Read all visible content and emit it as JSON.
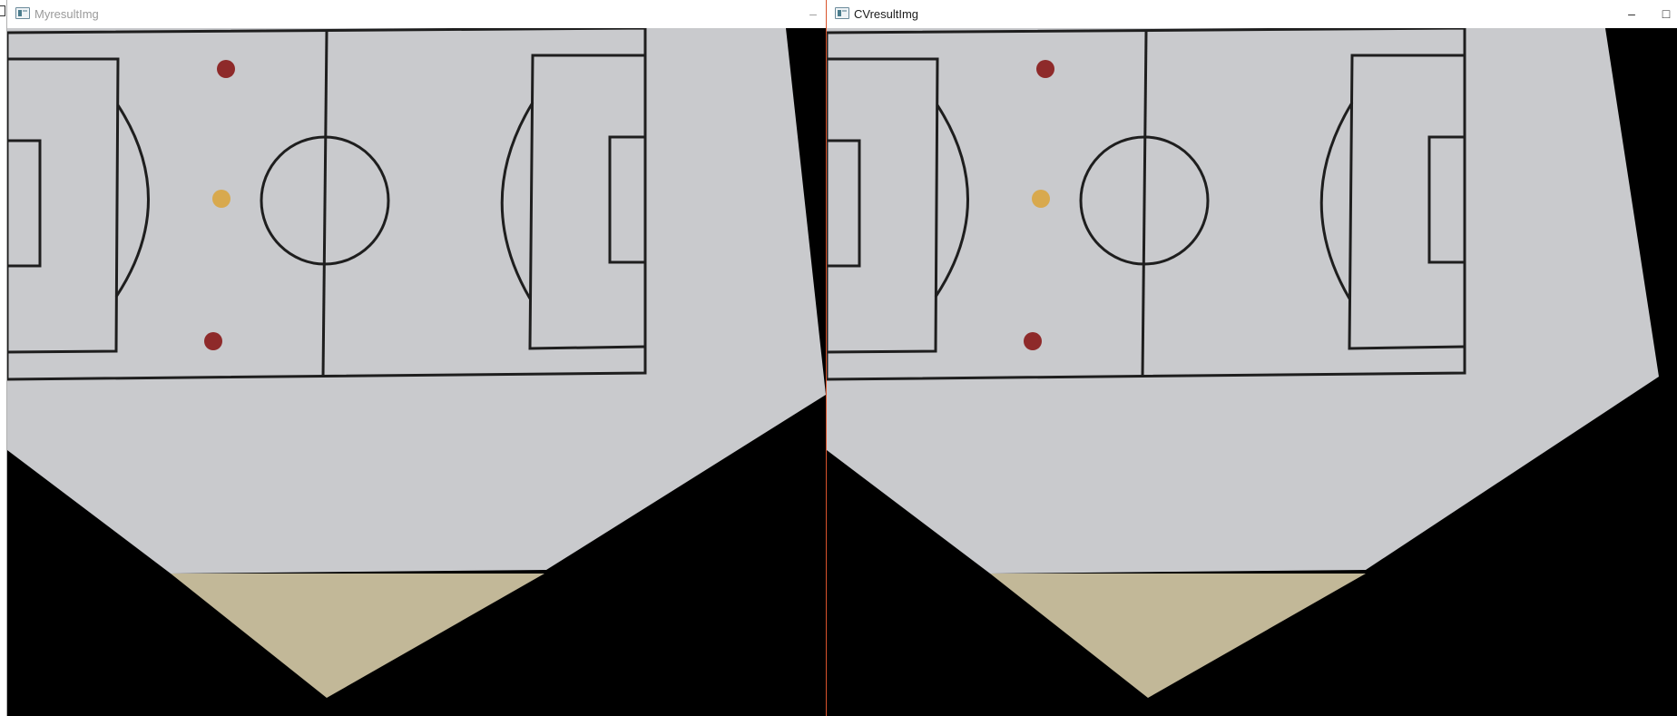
{
  "windows": [
    {
      "title": "MyresultImg",
      "active": false,
      "controls": {
        "minimize_icon": "minimize-icon"
      }
    },
    {
      "title": "CVresultImg",
      "active": true,
      "controls": {
        "minimize_icon": "minimize-icon",
        "maximize_icon": "maximize-icon"
      }
    }
  ],
  "scene": {
    "background_color": "#000000",
    "paper_color": "#c9cacd",
    "floor_color": "#c2b898",
    "line_color": "#1e1e1e",
    "markers": [
      {
        "name": "red-marker-top",
        "color": "#8e2a2a"
      },
      {
        "name": "yellow-marker",
        "color": "#d8a94e"
      },
      {
        "name": "red-marker-bottom",
        "color": "#8e2a2a"
      }
    ]
  },
  "accent_color": "#d9532c"
}
